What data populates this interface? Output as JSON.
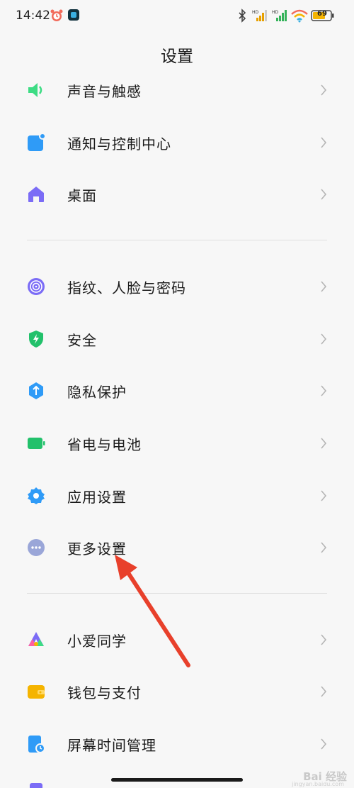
{
  "status_bar": {
    "time": "14:42",
    "battery": "69",
    "network_label": "HD"
  },
  "title": "设置",
  "groups": [
    {
      "items": [
        {
          "label": "声音与触感",
          "icon": "speaker-icon",
          "color": "#3ddc84"
        },
        {
          "label": "通知与控制中心",
          "icon": "notification-icon",
          "color": "#2f9bf7"
        },
        {
          "label": "桌面",
          "icon": "home-icon",
          "color": "#7b6cf6"
        }
      ]
    },
    {
      "items": [
        {
          "label": "指纹、人脸与密码",
          "icon": "fingerprint-icon",
          "color": "#7b6cf6"
        },
        {
          "label": "安全",
          "icon": "shield-icon",
          "color": "#22c16b"
        },
        {
          "label": "隐私保护",
          "icon": "privacy-icon",
          "color": "#2f9bf7"
        },
        {
          "label": "省电与电池",
          "icon": "battery-icon",
          "color": "#22c16b"
        },
        {
          "label": "应用设置",
          "icon": "gear-icon",
          "color": "#2f9bf7"
        },
        {
          "label": "更多设置",
          "icon": "more-icon",
          "color": "#9aa6d8"
        }
      ]
    },
    {
      "items": [
        {
          "label": "小爱同学",
          "icon": "xiaoai-icon",
          "color": "#7b6cf6"
        },
        {
          "label": "钱包与支付",
          "icon": "wallet-icon",
          "color": "#f5b400"
        },
        {
          "label": "屏幕时间管理",
          "icon": "screen-time-icon",
          "color": "#2f9bf7"
        }
      ]
    }
  ],
  "watermark": {
    "text": "Bai 经验",
    "sub": "jingyan.baidu.com"
  },
  "annotation": {
    "arrow_color": "#e8402b"
  }
}
